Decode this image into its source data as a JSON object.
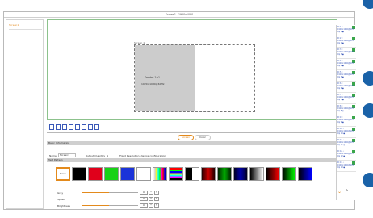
{
  "window": {
    "title": "Screen1 - 1920x1080"
  },
  "left_panel": {
    "items": [
      {
        "label": "Screen1"
      }
    ]
  },
  "canvas": {
    "screen_label": "Screen 1",
    "sender_label": "Sender 1→1",
    "sender_resolution": "1920×1080@60Hz"
  },
  "tabs": [
    {
      "label": "Screen"
    },
    {
      "label": "Color"
    }
  ],
  "basic_info": {
    "header": "Basic Information",
    "name_label": "Name",
    "name_value": "Screen1",
    "output_label": "Output Quantity",
    "output_value": "1",
    "fixed_label": "Fixed Resolution",
    "device_label": "device configuration"
  },
  "test_pattern": {
    "header": "Test Pattern",
    "none_label": "None",
    "swatch_colors": [
      "#000000",
      "#e0001b",
      "#17d216",
      "#1b33d8",
      "#ffffff",
      "gradient",
      "rainbow",
      "checker",
      "#7a0000",
      "#0a6b0a",
      "#0a1a6b",
      "gray-grad",
      "#c40000",
      "#0a8a0a",
      "#1040c0"
    ]
  },
  "adjust": {
    "rows": [
      {
        "label": "Gray",
        "value": "0",
        "level": 0.48
      },
      {
        "label": "Speed",
        "value": "0",
        "level": 0.48
      },
      {
        "label": "Brightness",
        "value": "0",
        "level": 0.48
      }
    ],
    "minus": "−",
    "plus": "+"
  },
  "right_panel": {
    "cards": [
      {
        "l1": "ID 1 ✓",
        "l2": "1920×1080@60Hz",
        "l3": "Op 1 ●"
      },
      {
        "l1": "ID 2 ✓",
        "l2": "1920×1080@60Hz",
        "l3": "Op 2 ●"
      },
      {
        "l1": "ID 3 ✓",
        "l2": "1920×1080@60Hz",
        "l3": "Op 3 ●"
      },
      {
        "l1": "ID 4 ✓",
        "l2": "1920×1080@60Hz",
        "l3": "Op 4 ●"
      },
      {
        "l1": "ID 5 ✓",
        "l2": "1920×1080@60Hz",
        "l3": "Op 5 ●"
      },
      {
        "l1": "ID 6 ✓",
        "l2": "1920×1080@60Hz",
        "l3": "Op 6 ●"
      },
      {
        "l1": "ID 7 ✓",
        "l2": "1920×1080@60Hz",
        "l3": "Op 7 ●"
      },
      {
        "l1": "ID 8 ✓",
        "l2": "1920×1080@60Hz",
        "l3": "Op 8 ●"
      },
      {
        "l1": "ID 9 ✓",
        "l2": "1920×1080@60Hz",
        "l3": "Op 9 ●"
      },
      {
        "l1": "ID 10 ✓",
        "l2": "1920×1080@60Hz",
        "l3": "Op 10 ●"
      },
      {
        "l1": "ID 11 ✓",
        "l2": "1920×1080@60Hz",
        "l3": "Op 11 ●"
      },
      {
        "l1": "ID 12 ✓",
        "l2": "1920×1080@60Hz",
        "l3": "Op 12 ●"
      },
      {
        "l1": "ID 13 ✓",
        "l2": "1920×1080@60Hz",
        "l3": "Op 13 ●"
      }
    ],
    "down_glyph": "⌄",
    "up_glyph": "⌃"
  },
  "colors": {
    "accent": "#e38a1c",
    "select_green": "#8cc28c",
    "badge_green": "#3aa64b",
    "icon_blue": "#3a58b8"
  }
}
